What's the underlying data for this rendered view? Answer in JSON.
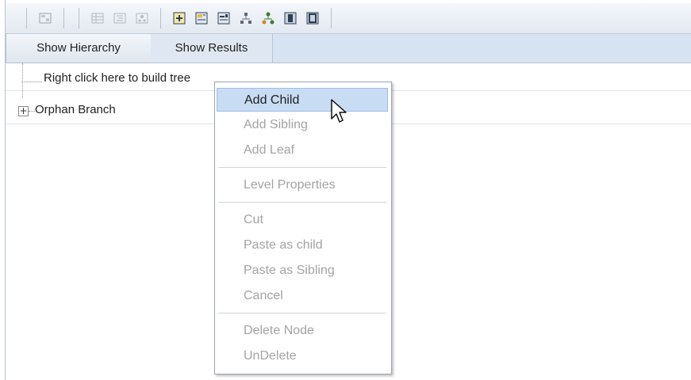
{
  "toolbar": {
    "icons": [
      "view-icon",
      "grid-icon",
      "indent-icon",
      "tree-icon",
      "add-box-icon",
      "expand-icon",
      "collapse-icon",
      "hierarchy-icon",
      "org-chart-icon",
      "column-icon",
      "panel-icon"
    ]
  },
  "tabs": [
    {
      "label": "Show Hierarchy",
      "active": true
    },
    {
      "label": "Show Results",
      "active": false
    }
  ],
  "tree": {
    "root_hint": "Right click here to build tree",
    "orphan_label": "Orphan Branch"
  },
  "context_menu": {
    "items": [
      {
        "label": "Add Child",
        "enabled": true,
        "highlighted": true
      },
      {
        "label": "Add Sibling",
        "enabled": false
      },
      {
        "label": "Add Leaf",
        "enabled": false
      },
      {
        "label": "Level Properties",
        "enabled": false
      },
      {
        "label": "Cut",
        "enabled": false
      },
      {
        "label": "Paste as child",
        "enabled": false
      },
      {
        "label": "Paste as Sibling",
        "enabled": false
      },
      {
        "label": "Cancel",
        "enabled": false
      },
      {
        "label": "Delete Node",
        "enabled": false
      },
      {
        "label": "UnDelete",
        "enabled": false
      }
    ]
  },
  "colors": {
    "highlight": "#c8dcf4",
    "disabled_text": "#a3a3a3",
    "tabbar": "#d7e3f0"
  }
}
